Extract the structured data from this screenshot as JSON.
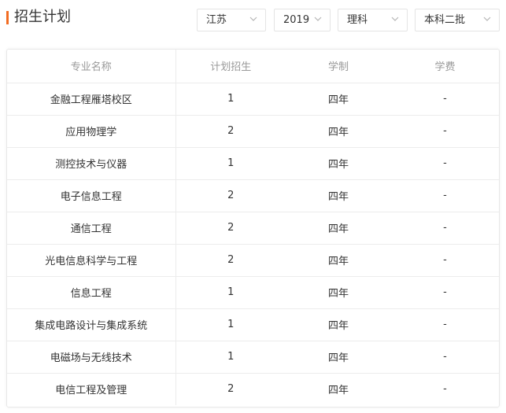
{
  "header": {
    "title": "招生计划"
  },
  "filters": {
    "province": "江苏",
    "year": "2019",
    "subject": "理科",
    "batch": "本科二批"
  },
  "table": {
    "columns": [
      "专业名称",
      "计划招生",
      "学制",
      "学费"
    ],
    "rows": [
      {
        "major": "金融工程雁塔校区",
        "plan": "1",
        "duration": "四年",
        "fee": "-"
      },
      {
        "major": "应用物理学",
        "plan": "2",
        "duration": "四年",
        "fee": "-"
      },
      {
        "major": "测控技术与仪器",
        "plan": "1",
        "duration": "四年",
        "fee": "-"
      },
      {
        "major": "电子信息工程",
        "plan": "2",
        "duration": "四年",
        "fee": "-"
      },
      {
        "major": "通信工程",
        "plan": "2",
        "duration": "四年",
        "fee": "-"
      },
      {
        "major": "光电信息科学与工程",
        "plan": "2",
        "duration": "四年",
        "fee": "-"
      },
      {
        "major": "信息工程",
        "plan": "1",
        "duration": "四年",
        "fee": "-"
      },
      {
        "major": "集成电路设计与集成系统",
        "plan": "1",
        "duration": "四年",
        "fee": "-"
      },
      {
        "major": "电磁场与无线技术",
        "plan": "1",
        "duration": "四年",
        "fee": "-"
      },
      {
        "major": "电信工程及管理",
        "plan": "2",
        "duration": "四年",
        "fee": "-"
      }
    ]
  },
  "colors": {
    "accent": "#f26c22",
    "border": "#e8e8e8",
    "header_text": "#999999",
    "body_text": "#333333"
  }
}
